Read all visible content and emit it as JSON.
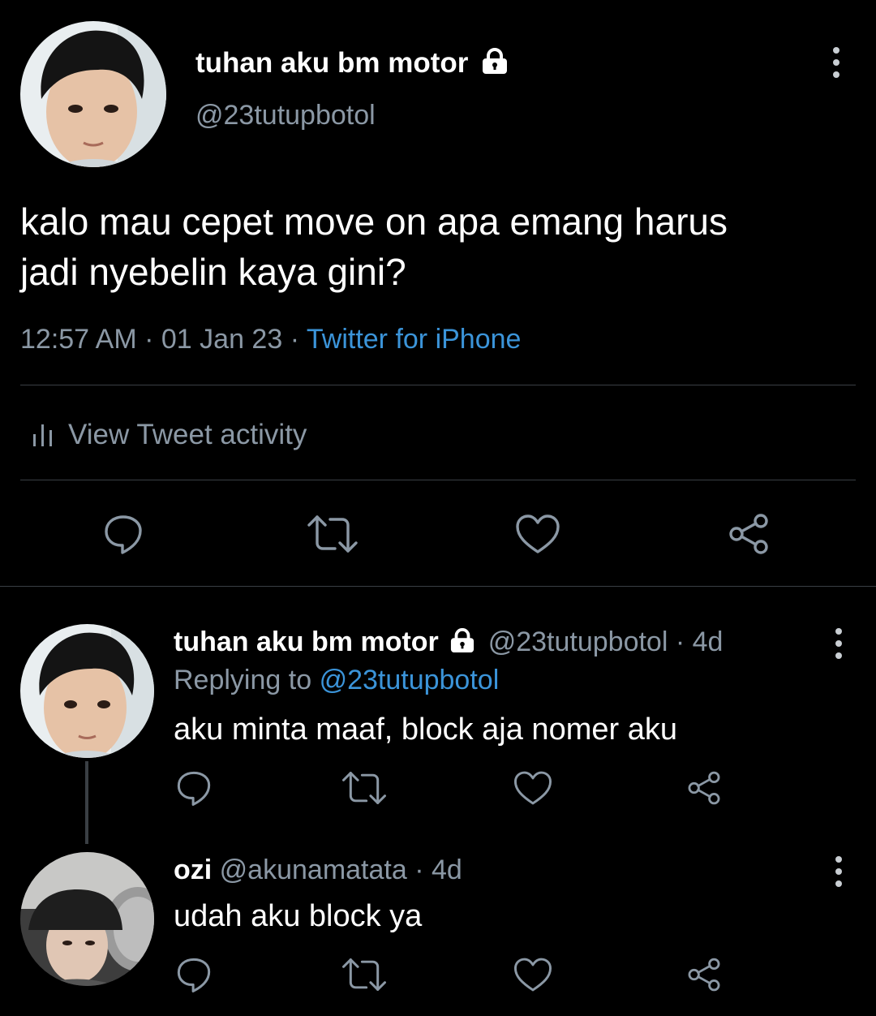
{
  "main_tweet": {
    "display_name": "tuhan aku bm motor",
    "handle": "@23tutupbotol",
    "text_line1": "kalo mau cepet move on apa emang harus",
    "text_line2": "jadi nyebelin kaya gini?",
    "time": "12:57 AM",
    "sep1": "·",
    "date": "01 Jan 23",
    "sep2": "·",
    "source": "Twitter for iPhone",
    "activity_label": "View Tweet activity"
  },
  "replies": [
    {
      "display_name": "tuhan aku bm motor",
      "handle": "@23tutupbotol",
      "age": "· 4d",
      "replying_prefix": "Replying to",
      "replying_handle": "@23tutupbotol",
      "text": "aku minta maaf, block aja nomer aku"
    },
    {
      "display_name": "ozi",
      "handle": "@akunamatata",
      "age": "· 4d",
      "text": "udah aku block ya"
    }
  ],
  "icons": {
    "lock": "lock-icon",
    "reply": "reply-icon",
    "retweet": "retweet-icon",
    "like": "heart-icon",
    "share": "share-icon",
    "more": "more-vertical-icon",
    "activity": "bar-chart-icon"
  },
  "colors": {
    "background": "#000000",
    "text": "#e7e9ea",
    "muted": "#8b98a5",
    "link": "#3b94d9",
    "divider": "#3a3f44"
  }
}
